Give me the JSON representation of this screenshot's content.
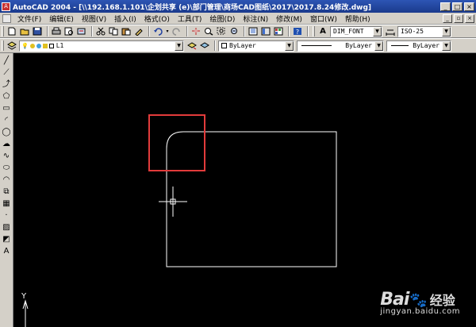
{
  "window": {
    "title": "AutoCAD 2004 - [\\\\192.168.1.101\\企划共享 (e)\\部门管理\\商场CAD图纸\\2017\\2017.8.24修改.dwg]",
    "app_icon": "A",
    "controls": {
      "minimize": "_",
      "maximize": "□",
      "close": "×"
    }
  },
  "menubar": {
    "items": [
      {
        "label": "文件(F)"
      },
      {
        "label": "编辑(E)"
      },
      {
        "label": "视图(V)"
      },
      {
        "label": "插入(I)"
      },
      {
        "label": "格式(O)"
      },
      {
        "label": "工具(T)"
      },
      {
        "label": "绘图(D)"
      },
      {
        "label": "标注(N)"
      },
      {
        "label": "修改(M)"
      },
      {
        "label": "窗口(W)"
      },
      {
        "label": "帮助(H)"
      }
    ],
    "doc_controls": {
      "minimize": "_",
      "restore": "▫",
      "close": "×"
    }
  },
  "styles_toolbar": {
    "text_style": "DIM_FONT",
    "dim_style": "ISO-25"
  },
  "layer_toolbar": {
    "layer": "L1",
    "color": "ByLayer",
    "linetype": "ByLayer",
    "lineweight": "ByLayer"
  },
  "standard_icons": [
    "new-icon",
    "open-icon",
    "save-icon",
    "print-icon",
    "preview-icon",
    "publish-icon",
    "cut-icon",
    "copy-icon",
    "paste-icon",
    "match-properties-icon",
    "undo-icon",
    "redo-icon",
    "pan-icon",
    "zoom-realtime-icon",
    "zoom-window-icon",
    "zoom-previous-icon",
    "properties-icon",
    "design-center-icon",
    "tool-palettes-icon",
    "help-icon"
  ],
  "draw_tools": [
    {
      "name": "line-tool-icon",
      "glyph": "╱"
    },
    {
      "name": "construction-line-icon",
      "glyph": "⟋"
    },
    {
      "name": "polyline-icon",
      "glyph": "⤴"
    },
    {
      "name": "polygon-icon",
      "glyph": "⬠"
    },
    {
      "name": "rectangle-icon",
      "glyph": "▭"
    },
    {
      "name": "arc-icon",
      "glyph": "◜"
    },
    {
      "name": "circle-icon",
      "glyph": "◯"
    },
    {
      "name": "revision-cloud-icon",
      "glyph": "☁"
    },
    {
      "name": "spline-icon",
      "glyph": "∿"
    },
    {
      "name": "ellipse-icon",
      "glyph": "⬭"
    },
    {
      "name": "ellipse-arc-icon",
      "glyph": "◠"
    },
    {
      "name": "insert-block-icon",
      "glyph": "⧉"
    },
    {
      "name": "make-block-icon",
      "glyph": "▦"
    },
    {
      "name": "point-icon",
      "glyph": "·"
    },
    {
      "name": "hatch-icon",
      "glyph": "▨"
    },
    {
      "name": "region-icon",
      "glyph": "◩"
    },
    {
      "name": "multiline-text-icon",
      "glyph": "A"
    }
  ],
  "ucs": {
    "y_label": "Y"
  },
  "watermark": {
    "brand": "Bai",
    "brand2": "du",
    "cn": "经验",
    "site": "jingyan.baidu.com"
  },
  "colors": {
    "highlight": "#e23b3b",
    "geometry": "#ffffff",
    "canvas": "#000000"
  }
}
